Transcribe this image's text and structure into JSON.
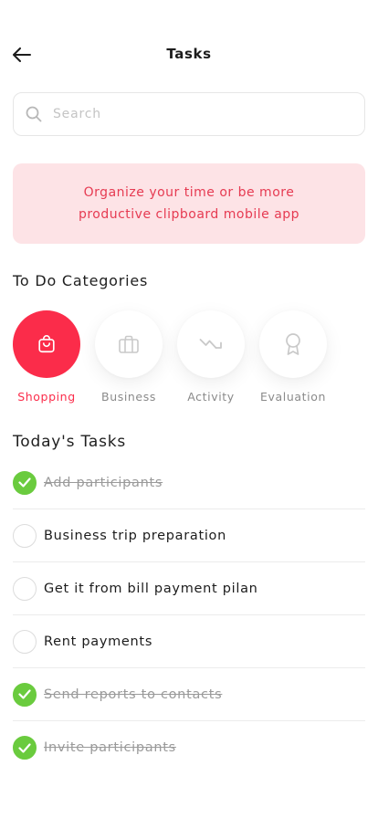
{
  "header": {
    "title": "Tasks"
  },
  "search": {
    "placeholder": "Search",
    "value": ""
  },
  "banner": {
    "line1": "Organize your time or be more",
    "line2": "productive clipboard mobile app"
  },
  "categories": {
    "heading": "To Do Categories",
    "items": [
      {
        "label": "Shopping",
        "icon": "shopping-bag-icon",
        "active": true
      },
      {
        "label": "Business",
        "icon": "briefcase-icon",
        "active": false
      },
      {
        "label": "Activity",
        "icon": "activity-icon",
        "active": false
      },
      {
        "label": "Evaluation",
        "icon": "award-icon",
        "active": false
      }
    ]
  },
  "tasks": {
    "heading": "Today's Tasks",
    "items": [
      {
        "label": "Add participants",
        "done": true
      },
      {
        "label": "Business trip preparation",
        "done": false
      },
      {
        "label": "Get it from bill payment pilan",
        "done": false
      },
      {
        "label": "Rent payments",
        "done": false
      },
      {
        "label": "Send reports to contacts",
        "done": true
      },
      {
        "label": "Invite participants",
        "done": true
      }
    ]
  },
  "colors": {
    "accent": "#fb2c4a",
    "banner_bg": "#fde3e6",
    "banner_text": "#e63b52",
    "done_green": "#6acb3e"
  }
}
